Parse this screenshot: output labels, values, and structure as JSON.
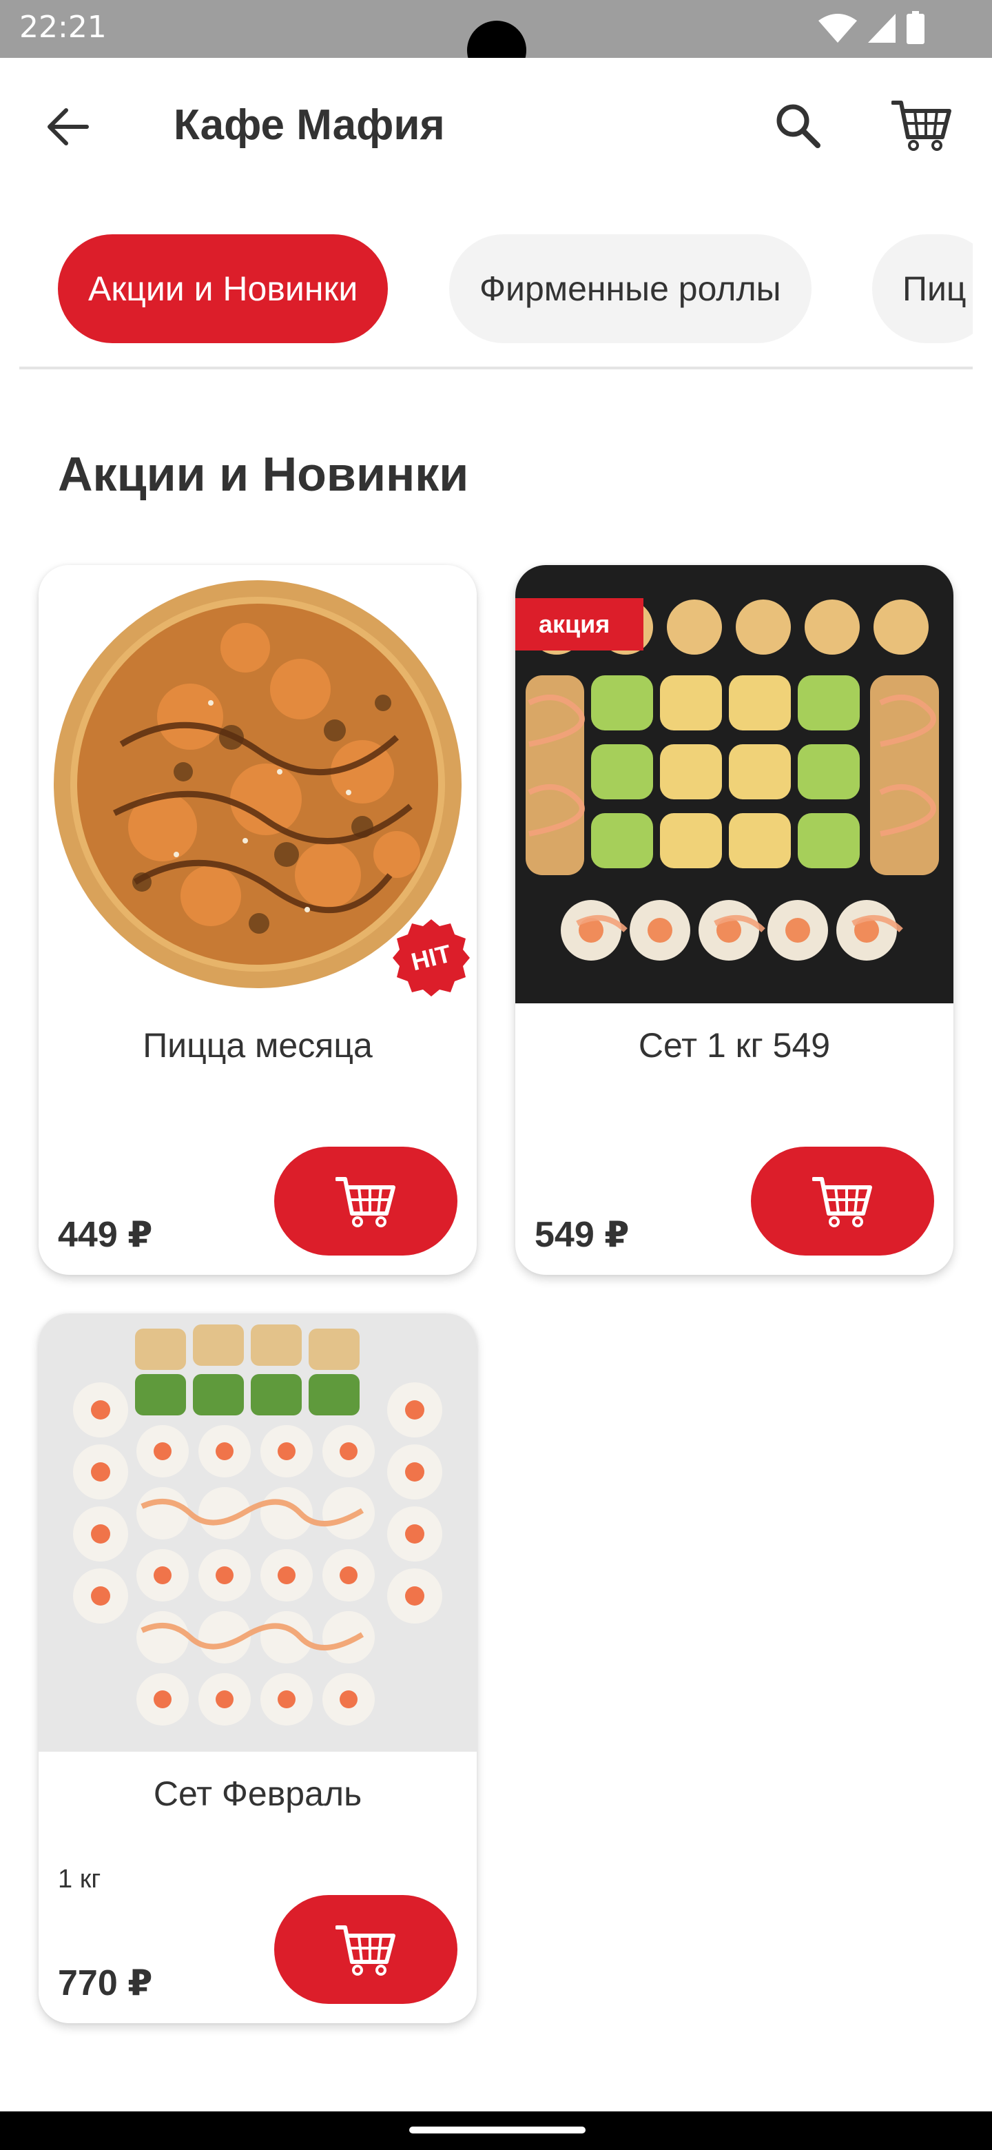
{
  "status_bar": {
    "time": "22:21"
  },
  "app_bar": {
    "title": "Кафе Мафия"
  },
  "categories": [
    {
      "label": "Акции и Новинки",
      "active": true
    },
    {
      "label": "Фирменные роллы",
      "active": false
    },
    {
      "label": "Пиц",
      "active": false
    }
  ],
  "section": {
    "title": "Акции и Новинки"
  },
  "products": [
    {
      "name": "Пицца месяца",
      "weight": "",
      "price": "449 ₽",
      "badge": "HIT",
      "image": "pizza"
    },
    {
      "name": "Сет 1 кг 549",
      "weight": "",
      "price": "549 ₽",
      "badge": "акция",
      "image": "sushi-dark"
    },
    {
      "name": "Сет Февраль",
      "weight": "1 кг",
      "price": "770 ₽",
      "badge": "",
      "image": "sushi-light"
    }
  ],
  "colors": {
    "accent": "#dc1e2a",
    "status_bar": "#9e9e9e",
    "chip_inactive": "#f3f3f3"
  },
  "icons": [
    "back-arrow-icon",
    "search-icon",
    "cart-icon",
    "wifi-icon",
    "signal-icon",
    "battery-icon"
  ]
}
